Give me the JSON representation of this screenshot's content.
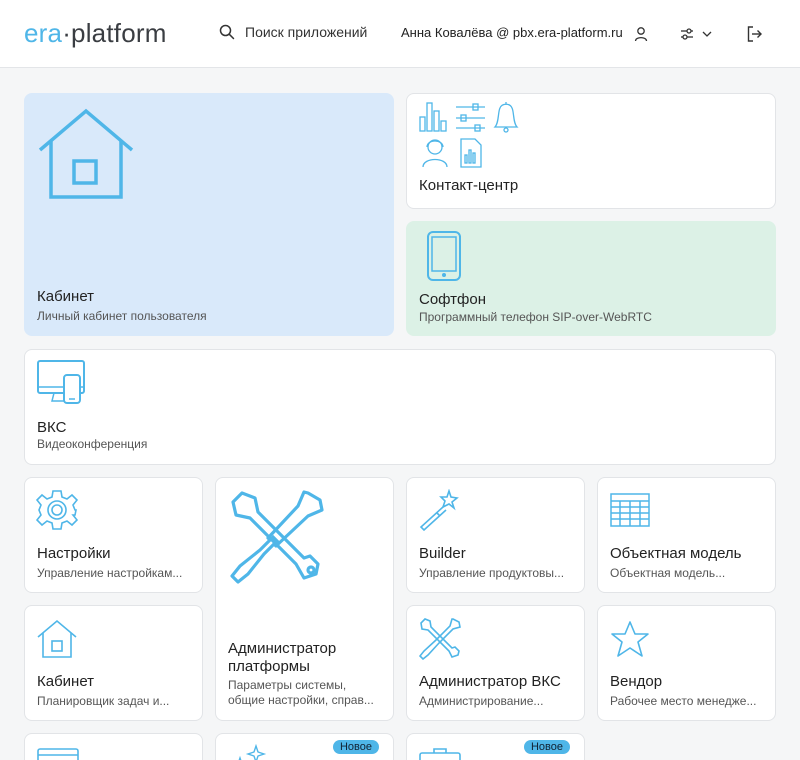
{
  "header": {
    "logo_part1": "era",
    "logo_dot": "·",
    "logo_part2": "platform",
    "search_label": "Поиск приложений",
    "user_label": "Анна Ковалёва @ pbx.era-platform.ru"
  },
  "cards": {
    "cabinet_main": {
      "title": "Кабинет",
      "subtitle": "Личный кабинет пользователя"
    },
    "contact_center": {
      "title": "Контакт-центр"
    },
    "softphone": {
      "title": "Софтфон",
      "subtitle": "Программный телефон SIP-over-WebRTC"
    },
    "vks": {
      "title": "ВКС",
      "subtitle": "Видеоконференция"
    },
    "settings": {
      "title": "Настройки",
      "subtitle": "Управление настройкам..."
    },
    "platform_admin": {
      "title": "Администратор платформы",
      "subtitle": "Параметры системы, общие настройки, справ..."
    },
    "builder": {
      "title": "Builder",
      "subtitle": "Управление продуктовы..."
    },
    "object_model": {
      "title": "Объектная модель",
      "subtitle": "Объектная модель..."
    },
    "cabinet_small": {
      "title": "Кабинет",
      "subtitle": "Планировщик задач и..."
    },
    "vks_admin": {
      "title": "Администратор ВКС",
      "subtitle": "Администрирование..."
    },
    "vendor": {
      "title": "Вендор",
      "subtitle": "Рабочее место менедже..."
    },
    "new_badge_1": "Новое",
    "new_badge_2": "Новое"
  },
  "colors": {
    "accent": "#4fb6e8",
    "blue_card": "#d9e9fa",
    "green_card": "#dcf1e6"
  }
}
